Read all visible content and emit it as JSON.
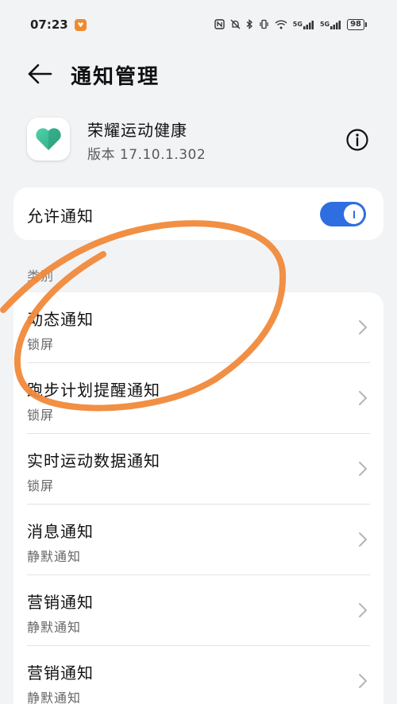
{
  "status_bar": {
    "time": "07:23",
    "network_labels": [
      "5G",
      "5G"
    ],
    "battery": "98"
  },
  "header": {
    "title": "通知管理"
  },
  "app": {
    "name": "荣耀运动健康",
    "version": "版本 17.10.1.302",
    "icon_color": "#3fbf9a"
  },
  "allow": {
    "label": "允许通知",
    "enabled": true,
    "accent": "#2f6ee0"
  },
  "category_label": "类别",
  "items": [
    {
      "title": "动态通知",
      "subtitle": "锁屏"
    },
    {
      "title": "跑步计划提醒通知",
      "subtitle": "锁屏"
    },
    {
      "title": "实时运动数据通知",
      "subtitle": "锁屏"
    },
    {
      "title": "消息通知",
      "subtitle": "静默通知"
    },
    {
      "title": "营销通知",
      "subtitle": "静默通知"
    },
    {
      "title": "营销通知",
      "subtitle": "静默通知"
    }
  ],
  "annotation_color": "#f0893a"
}
